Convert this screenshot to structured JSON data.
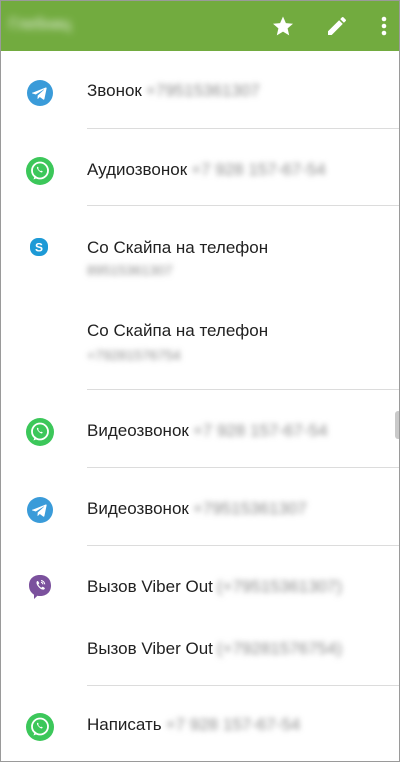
{
  "appbar": {
    "title": "Глебниц",
    "bg_color": "#72ab3f",
    "actions": [
      {
        "name": "star-icon"
      },
      {
        "name": "edit-icon"
      },
      {
        "name": "more-vert-icon"
      }
    ]
  },
  "items": [
    {
      "app": "telegram",
      "icon": "telegram-icon",
      "color": "#3a9bd9",
      "label": "Звонок",
      "number": "+79515361307"
    },
    {
      "app": "whatsapp",
      "icon": "whatsapp-icon",
      "color": "#3cc75a",
      "label": "Аудиозвонок",
      "number": "+7 928 157-67-54"
    },
    {
      "app": "skype",
      "icon": "skype-icon",
      "color": "#1d9ad6",
      "label": "Со Скайпа на телефон",
      "number": "89515361307"
    },
    {
      "app": "skype",
      "icon": "",
      "color": "",
      "label": "Со Скайпа на телефон",
      "number": "+79281576754"
    },
    {
      "app": "whatsapp",
      "icon": "whatsapp-icon",
      "color": "#3cc75a",
      "label": "Видеозвонок",
      "number": "+7 928 157-67-54"
    },
    {
      "app": "telegram",
      "icon": "telegram-icon",
      "color": "#3a9bd9",
      "label": "Видеозвонок",
      "number": "+79515361307"
    },
    {
      "app": "viber",
      "icon": "viber-icon",
      "color": "#7b519d",
      "label": "Вызов Viber Out",
      "number": "(+79515361307)"
    },
    {
      "app": "viber",
      "icon": "",
      "color": "",
      "label": "Вызов Viber Out",
      "number": "(+79281576754)"
    },
    {
      "app": "whatsapp",
      "icon": "whatsapp-icon",
      "color": "#3cc75a",
      "label": "Написать",
      "number": "+7 928 157-67-54"
    }
  ]
}
